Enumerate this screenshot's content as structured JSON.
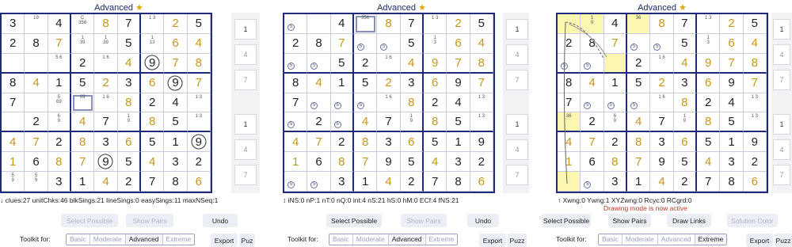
{
  "panels": [
    {
      "title": "Advanced",
      "stats": "↓ clues:27  unitChks:46  blkSings:21  lineSings:0  easySings:11  maxNSeq:1",
      "buttons": {
        "select_possible": "Select Possible",
        "show_pairs": "Show Pairs",
        "third": "Undo"
      },
      "toolkit_label": "Toolkit for:",
      "levels": [
        "Basic",
        "Moderate",
        "Advanced",
        "Extreme"
      ],
      "active_level": "Advanced",
      "export": "Export",
      "puzzle": "Puz"
    },
    {
      "title": "Advanced",
      "stats": "↕ iNS:0  nP:1  nT:0  nQ:0  int:4  nS:21  hS:0  hM:0  ECf:4  fNS:21",
      "buttons": {
        "select_possible": "Select Possible",
        "show_pairs": "Show Pairs",
        "third": "Undo"
      },
      "toolkit_label": "Toolkit for:",
      "levels": [
        "Basic",
        "Moderate",
        "Advanced",
        "Extreme"
      ],
      "active_level": "Advanced",
      "export": "Export",
      "puzzle": "Puzz"
    },
    {
      "title": "Advanced",
      "stats": "↑ Xwng:0  Ywng:1  XYZwng:0  Rcyc:0  RCgrd:0",
      "message": "Drawing mode is now active",
      "buttons": {
        "select_possible": "Select Possible",
        "show_pairs": "Show Pairs",
        "draw_links": "Draw Links",
        "solution_color": "Solution Color"
      },
      "toolkit_label": "Toolkit for:",
      "levels": [
        "Basic",
        "Moderate",
        "Advanced",
        "Extreme"
      ],
      "active_level": "Extreme",
      "export": "Export",
      "puzzle": "Puzz"
    }
  ],
  "boards": [
    {
      "cells": [
        "3|19|4|C:356|8|7|1 3|2|5",
        "2|8|7|1:39|1:39|5|1:13|6|4",
        ".|.|5 6|2|1 6|4|O9|7|8",
        "8|4|1|5|2|3|6|O9|7",
        "7|.|5:69|S:69|1 6|8|2|4|1 3",
        ".|2|6:9|4|7|1:9|8|5|1 3",
        "4|7|2|8|3|6|5|1|O9",
        "1|6|8|7|O9|5|4|3|2",
        "5:9|5:9|3|1|4|2|7|8|6"
      ]
    },
    {
      "cells": [
        "m|.|4|S:356|8|7|1 3|2|5",
        "2|8|7|m|m|5|1:3|6|4",
        "m|m|5|2|1 6|4|9|7|8",
        "8|4|1|5|2|3|6|9|7",
        "7|m|m|m|1 6|8|2|4|1 3",
        "m|2|m|4|7|1:9|8|5|1 3",
        "4|7|2|8|3|6|5|1|9",
        "1|6|8|7|9|5|4|3|2",
        "m|m|3|1|4|2|7|8|6"
      ]
    },
    {
      "cells": [
        "Y|Y:1:9|4|Y:36|8|7|1 3|2|5",
        "2|8|7|m|m|5|1:3|6|4",
        "m|m|Y|2|1 6|4|9|7|8",
        "8|4|1|5|2|3|6|9|7",
        "7|m|m|m|1 6|8|2|4|1 3",
        "Y:36|2|6:9|4|7|1:9|8|5|1 3",
        "4|7|2|8|3|6|5|1|9",
        "1|6|8|7|9|5|4|3|2",
        "Y|m|3|1|4|2|7|8|6"
      ]
    }
  ],
  "side_digits": [
    "1",
    "4",
    "7",
    "1",
    "4",
    "7"
  ]
}
